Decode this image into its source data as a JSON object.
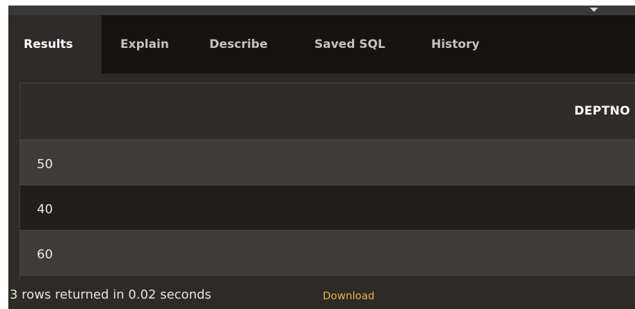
{
  "tabs": [
    {
      "label": "Results",
      "active": true
    },
    {
      "label": "Explain",
      "active": false
    },
    {
      "label": "Describe",
      "active": false
    },
    {
      "label": "Saved SQL",
      "active": false
    },
    {
      "label": "History",
      "active": false
    }
  ],
  "results": {
    "columns": [
      "DEPTNO"
    ],
    "rows": [
      {
        "DEPTNO": "50"
      },
      {
        "DEPTNO": "40"
      },
      {
        "DEPTNO": "60"
      }
    ]
  },
  "footer": {
    "status": "3 rows returned in 0.02 seconds",
    "download_label": "Download"
  },
  "colors": {
    "accent_link": "#e8b33a",
    "tabbar_bg": "#161412",
    "panel_bg": "#2d2a28"
  },
  "icons": {
    "splitter": "caret-down-icon"
  }
}
